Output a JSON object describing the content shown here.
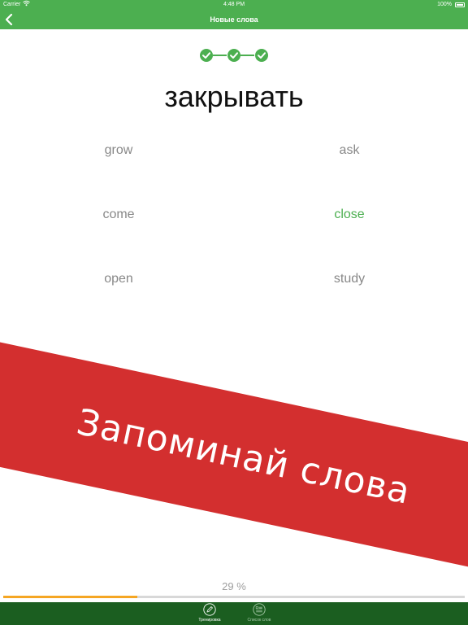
{
  "status_bar": {
    "carrier": "Carrier",
    "time": "4:48 PM",
    "battery": "100%"
  },
  "nav": {
    "title": "Новые слова",
    "back_icon": "chevron-left-icon"
  },
  "steps": {
    "completed": 3,
    "total": 3,
    "icon": "check-circle-icon"
  },
  "question": {
    "word": "закрывать"
  },
  "options": [
    {
      "label": "grow",
      "correct": false
    },
    {
      "label": "ask",
      "correct": false
    },
    {
      "label": "come",
      "correct": false
    },
    {
      "label": "close",
      "correct": true
    },
    {
      "label": "open",
      "correct": false
    },
    {
      "label": "study",
      "correct": false
    }
  ],
  "banner": {
    "text": "Запоминай слова"
  },
  "progress": {
    "label": "29 %",
    "value": 0.29
  },
  "tabs": [
    {
      "label": "Тренировка",
      "icon": "pencil-icon",
      "active": true
    },
    {
      "label": "Список слов",
      "icon": "list-icon",
      "active": false
    }
  ],
  "colors": {
    "accent": "#4caf50",
    "tab_bar": "#1b5e20",
    "banner": "#d32f2f",
    "progress": "#f5a623",
    "option_text": "#888888"
  }
}
